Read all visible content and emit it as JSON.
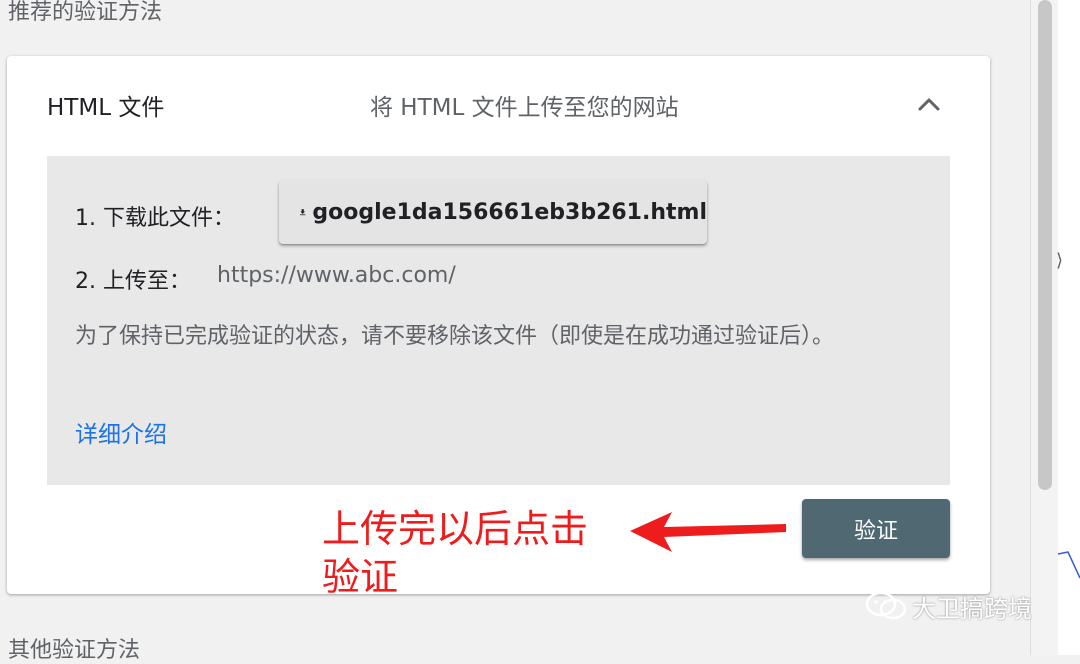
{
  "section": {
    "recommended_title": "推荐的验证方法",
    "other_title": "其他验证方法"
  },
  "method": {
    "name": "HTML 文件",
    "description": "将 HTML 文件上传至您的网站",
    "collapse_icon": "chevron-up-icon"
  },
  "steps": {
    "step1_label": "1. 下载此文件：",
    "download_file": "google1da156661eb3b261.html",
    "download_icon": "download-icon",
    "step2_label": "2. 上传至：",
    "step2_url": "https://www.abc.com/"
  },
  "note": "为了保持已完成验证的状态，请不要移除该文件（即使是在成功通过验证后）。",
  "learn_more": "详细介绍",
  "verify_button": "验证",
  "annotation": {
    "text": "上传完以后点击验证",
    "color": "#ee1c1c"
  },
  "watermark": "大卫搞跨境",
  "colors": {
    "link": "#1a73e8",
    "verify_button_bg": "#4f6872"
  }
}
